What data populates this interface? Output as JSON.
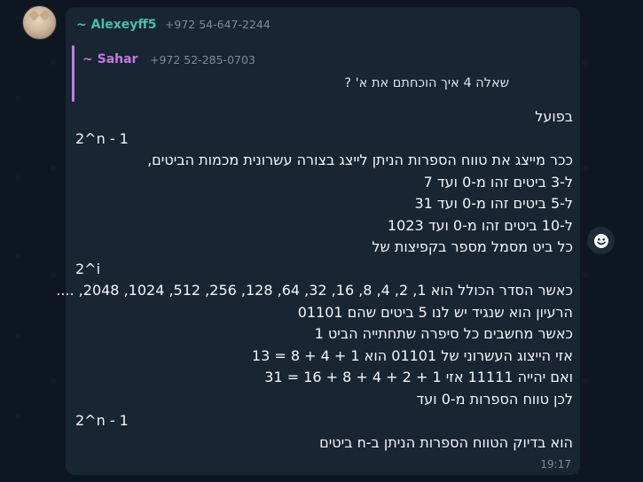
{
  "message": {
    "sender_name": "~ Alexeyff5",
    "sender_phone": "+972 54-647-2244",
    "reply": {
      "name": "~ Sahar",
      "phone": "+972 52-285-0703",
      "text": "שאלה 4 איך הוכחתם את א' ?"
    },
    "lines": [
      {
        "text": "בפועל",
        "dir": "rtl"
      },
      {
        "text": "2^n - 1",
        "dir": "ltr"
      },
      {
        "text": "ככר מייצג את טווח הספרות הניתן לייצג בצורה עשרונית מכמות הביטים,",
        "dir": "rtl"
      },
      {
        "text": "ל-3 ביטים זהו מ-0 ועד 7",
        "dir": "rtl"
      },
      {
        "text": "ל-5 ביטים זהו מ-0 ועד 31",
        "dir": "rtl"
      },
      {
        "text": "ל-10 ביטים זהו מ-0 ועד 1023",
        "dir": "rtl"
      },
      {
        "text": "כל ביט מסמל מספר בקפיצות של",
        "dir": "rtl"
      },
      {
        "text": "2^i",
        "dir": "ltr"
      },
      {
        "text": "כאשר הסדר הכולל הוא 1, 2, 4, 8, 16, 32, 64, 128, 256, 512, 1024, 2048, ....",
        "dir": "rtl"
      },
      {
        "text": "הרעיון הוא שנגיד יש לנו 5 ביטים שהם 01101",
        "dir": "rtl"
      },
      {
        "text": "כאשר מחשבים כל סיפרה שתחתייה הביט 1",
        "dir": "rtl"
      },
      {
        "text": "אזי הייצוג העשרוני של 01101 הוא 1 + 4 + 8 = 13",
        "dir": "rtl"
      },
      {
        "text": "ואם יהייה 11111 אזי 1 + 2 + 4 + 8 + 16 = 31",
        "dir": "rtl"
      },
      {
        "text": "לכן טווח הספרות מ-0 ועד",
        "dir": "rtl"
      },
      {
        "text": "2^n - 1",
        "dir": "ltr"
      },
      {
        "text": "הוא בדיוק הטווח הספרות הניתן ב-n ביטים",
        "dir": "rtl"
      }
    ],
    "time": "19:17"
  },
  "icons": {
    "avatar": "cat-avatar",
    "reaction": "emoji-icon"
  },
  "colors": {
    "background": "#0e1621",
    "bubble": "#182533",
    "sender_name": "#4fbcae",
    "reply_accent": "#c777e0",
    "meta": "#7d8b99"
  }
}
